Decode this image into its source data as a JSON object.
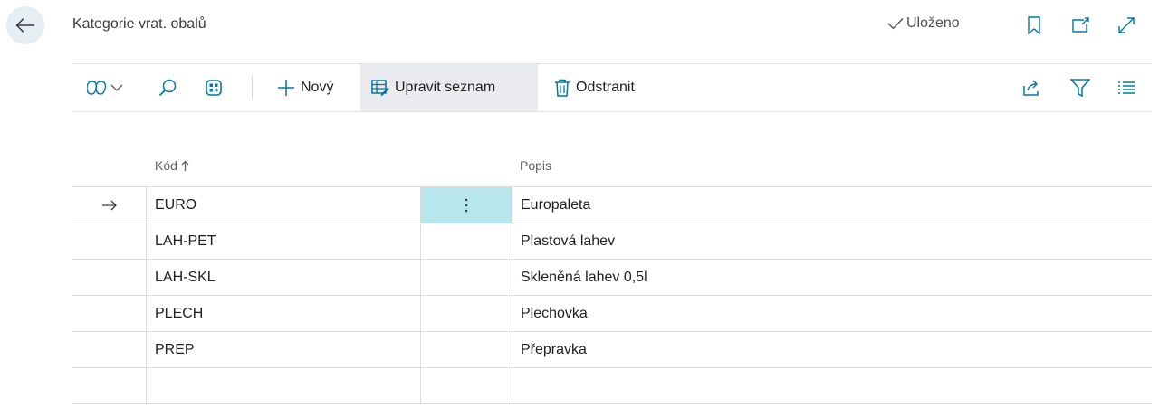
{
  "header": {
    "title": "Kategorie vrat. obalů",
    "saved_label": "Uloženo"
  },
  "toolbar": {
    "new_label": "Nový",
    "edit_list_label": "Upravit seznam",
    "delete_label": "Odstranit"
  },
  "columns": {
    "code": "Kód",
    "description": "Popis"
  },
  "rows": [
    {
      "code": "EURO",
      "description": "Europaleta"
    },
    {
      "code": "LAH-PET",
      "description": "Plastová lahev"
    },
    {
      "code": "LAH-SKL",
      "description": "Skleněná lahev 0,5l"
    },
    {
      "code": "PLECH",
      "description": "Plechovka"
    },
    {
      "code": "PREP",
      "description": "Přepravka"
    },
    {
      "code": "",
      "description": ""
    }
  ],
  "selected_row_index": 0,
  "icons": [
    "back-arrow-icon",
    "checkmark-icon",
    "bookmark-icon",
    "open-new-window-icon",
    "expand-icon",
    "copilot-icon",
    "chevron-down-icon",
    "search-icon",
    "analyze-icon",
    "plus-icon",
    "edit-list-icon",
    "trash-icon",
    "share-icon",
    "filter-icon",
    "list-view-icon",
    "sort-ascending-icon",
    "row-arrow-icon",
    "more-options-icon"
  ],
  "colors": {
    "accent": "#0078a3",
    "active_cell": "#b7e6ec",
    "edit_button_bg": "#e9ebee",
    "back_button_bg": "#e4eef3"
  }
}
